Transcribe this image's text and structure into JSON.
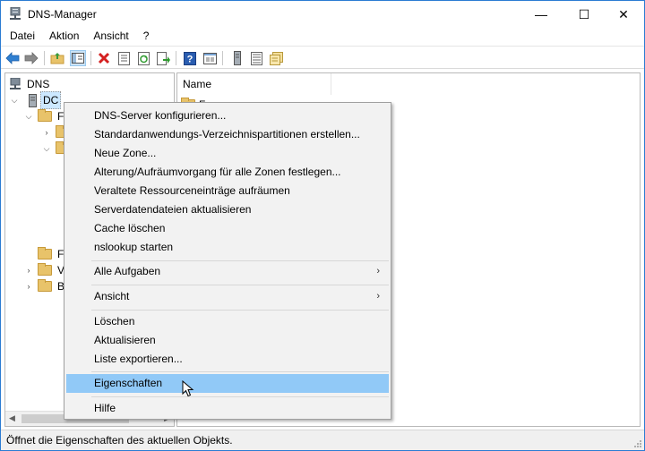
{
  "window": {
    "title": "DNS-Manager"
  },
  "titlebar": {
    "minimize": "—",
    "maximize": "☐",
    "close": "✕"
  },
  "menu": [
    "Datei",
    "Aktion",
    "Ansicht",
    "?"
  ],
  "toolbar": {
    "icons": [
      "back-icon",
      "forward-icon",
      "up-folder-icon",
      "show-hide-tree-icon",
      "delete-icon",
      "properties-icon",
      "refresh-icon",
      "export-list-icon",
      "help-icon",
      "console-icon",
      "server-icon",
      "list-icon",
      "zone-icon"
    ]
  },
  "tree": {
    "root": "DNS",
    "server": "DC",
    "partial_items": [
      "F",
      "",
      "",
      "F",
      "V",
      "B"
    ]
  },
  "list": {
    "column_name": "Name",
    "first_item_partial": "F"
  },
  "context_menu": {
    "items": [
      "DNS-Server konfigurieren...",
      "Standardanwendungs-Verzeichnispartitionen erstellen...",
      "Neue Zone...",
      "Alterung/Aufräumvorgang für alle Zonen festlegen...",
      "Veraltete Ressourceneinträge aufräumen",
      "Serverdatendateien aktualisieren",
      "Cache löschen",
      "nslookup starten"
    ],
    "submenus": [
      "Alle Aufgaben",
      "Ansicht"
    ],
    "actions": [
      "Löschen",
      "Aktualisieren",
      "Liste exportieren..."
    ],
    "highlighted": "Eigenschaften",
    "help": "Hilfe",
    "submenu_arrow": "›"
  },
  "status": {
    "text": "Öffnet die Eigenschaften des aktuellen Objekts."
  },
  "colors": {
    "accent": "#2b7cd3",
    "highlight": "#91c9f7",
    "menu_bg": "#f2f2f2"
  }
}
